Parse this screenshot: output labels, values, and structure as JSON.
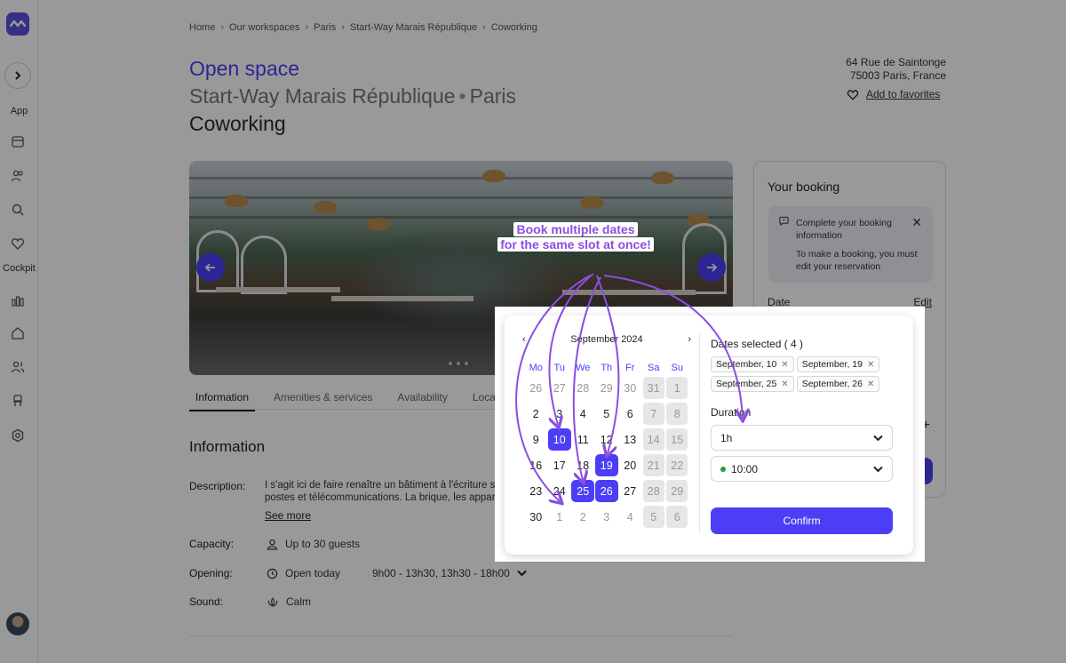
{
  "sidebar": {
    "app_label": "App",
    "cockpit_label": "Cockpit",
    "icons": [
      "calendar-icon",
      "users-icon",
      "search-icon",
      "heart-icon",
      "chart-icon",
      "home-icon",
      "team-icon",
      "chair-icon",
      "settings-icon"
    ]
  },
  "breadcrumb": [
    "Home",
    "Our workspaces",
    "Paris",
    "Start-Way Marais République",
    "Coworking"
  ],
  "header": {
    "title_accent": "Open space",
    "title_place": "Start-Way Marais République",
    "title_city": "Paris",
    "title_type": "Coworking",
    "address_line1": "64 Rue de Saintonge",
    "address_line2": "75003 Paris, France",
    "favorite_label": "Add to favorites"
  },
  "tabs": [
    "Information",
    "Amenities & services",
    "Availability",
    "Location"
  ],
  "info": {
    "section_title": "Information",
    "description_label": "Description:",
    "description_line1": "I s'agit ici de faire renaître un bâtiment à l'écriture s",
    "description_line2": "postes et télécommunications. La brique, les appar",
    "see_more": "See more",
    "capacity_label": "Capacity:",
    "capacity_value": "Up to 30 guests",
    "opening_label": "Opening:",
    "opening_value": "Open today",
    "opening_hours": "9h00 - 13h30, 13h30 - 18h00",
    "sound_label": "Sound:",
    "sound_value": "Calm"
  },
  "booking": {
    "title": "Your booking",
    "notice_title": "Complete your booking information",
    "notice_body": "To make a booking, you must edit your reservation",
    "date_label": "Date",
    "edit_label": "Edit"
  },
  "promo": {
    "line1": "Book multiple dates",
    "line2": "for the same slot at once!"
  },
  "calendar": {
    "month": "September 2024",
    "weekdays": [
      "Mo",
      "Tu",
      "We",
      "Th",
      "Fr",
      "Sa",
      "Su"
    ],
    "weeks": [
      [
        {
          "d": "26",
          "t": "muted"
        },
        {
          "d": "27",
          "t": "muted"
        },
        {
          "d": "28",
          "t": "muted"
        },
        {
          "d": "29",
          "t": "muted"
        },
        {
          "d": "30",
          "t": "muted"
        },
        {
          "d": "31",
          "t": "weekend"
        },
        {
          "d": "1",
          "t": "weekend"
        }
      ],
      [
        {
          "d": "2",
          "t": ""
        },
        {
          "d": "3",
          "t": ""
        },
        {
          "d": "4",
          "t": ""
        },
        {
          "d": "5",
          "t": ""
        },
        {
          "d": "6",
          "t": ""
        },
        {
          "d": "7",
          "t": "weekend"
        },
        {
          "d": "8",
          "t": "weekend"
        }
      ],
      [
        {
          "d": "9",
          "t": ""
        },
        {
          "d": "10",
          "t": "sel"
        },
        {
          "d": "11",
          "t": ""
        },
        {
          "d": "12",
          "t": ""
        },
        {
          "d": "13",
          "t": ""
        },
        {
          "d": "14",
          "t": "weekend"
        },
        {
          "d": "15",
          "t": "weekend"
        }
      ],
      [
        {
          "d": "16",
          "t": ""
        },
        {
          "d": "17",
          "t": ""
        },
        {
          "d": "18",
          "t": ""
        },
        {
          "d": "19",
          "t": "sel"
        },
        {
          "d": "20",
          "t": ""
        },
        {
          "d": "21",
          "t": "weekend"
        },
        {
          "d": "22",
          "t": "weekend"
        }
      ],
      [
        {
          "d": "23",
          "t": ""
        },
        {
          "d": "24",
          "t": ""
        },
        {
          "d": "25",
          "t": "sel"
        },
        {
          "d": "26",
          "t": "sel"
        },
        {
          "d": "27",
          "t": ""
        },
        {
          "d": "28",
          "t": "weekend"
        },
        {
          "d": "29",
          "t": "weekend"
        }
      ],
      [
        {
          "d": "30",
          "t": ""
        },
        {
          "d": "1",
          "t": "muted"
        },
        {
          "d": "2",
          "t": "muted"
        },
        {
          "d": "3",
          "t": "muted"
        },
        {
          "d": "4",
          "t": "muted"
        },
        {
          "d": "5",
          "t": "weekend"
        },
        {
          "d": "6",
          "t": "weekend"
        }
      ]
    ]
  },
  "selection": {
    "dates_title": "Dates selected ( 4 )",
    "chips": [
      "September, 10",
      "September, 19",
      "September, 25",
      "September, 26"
    ],
    "duration_label": "Duration",
    "duration_value": "1h",
    "time_value": "10:00",
    "confirm_label": "Confirm"
  },
  "colors": {
    "accent": "#4c3ef5",
    "promo": "#8a4ee0",
    "available": "#2f9a3a"
  }
}
